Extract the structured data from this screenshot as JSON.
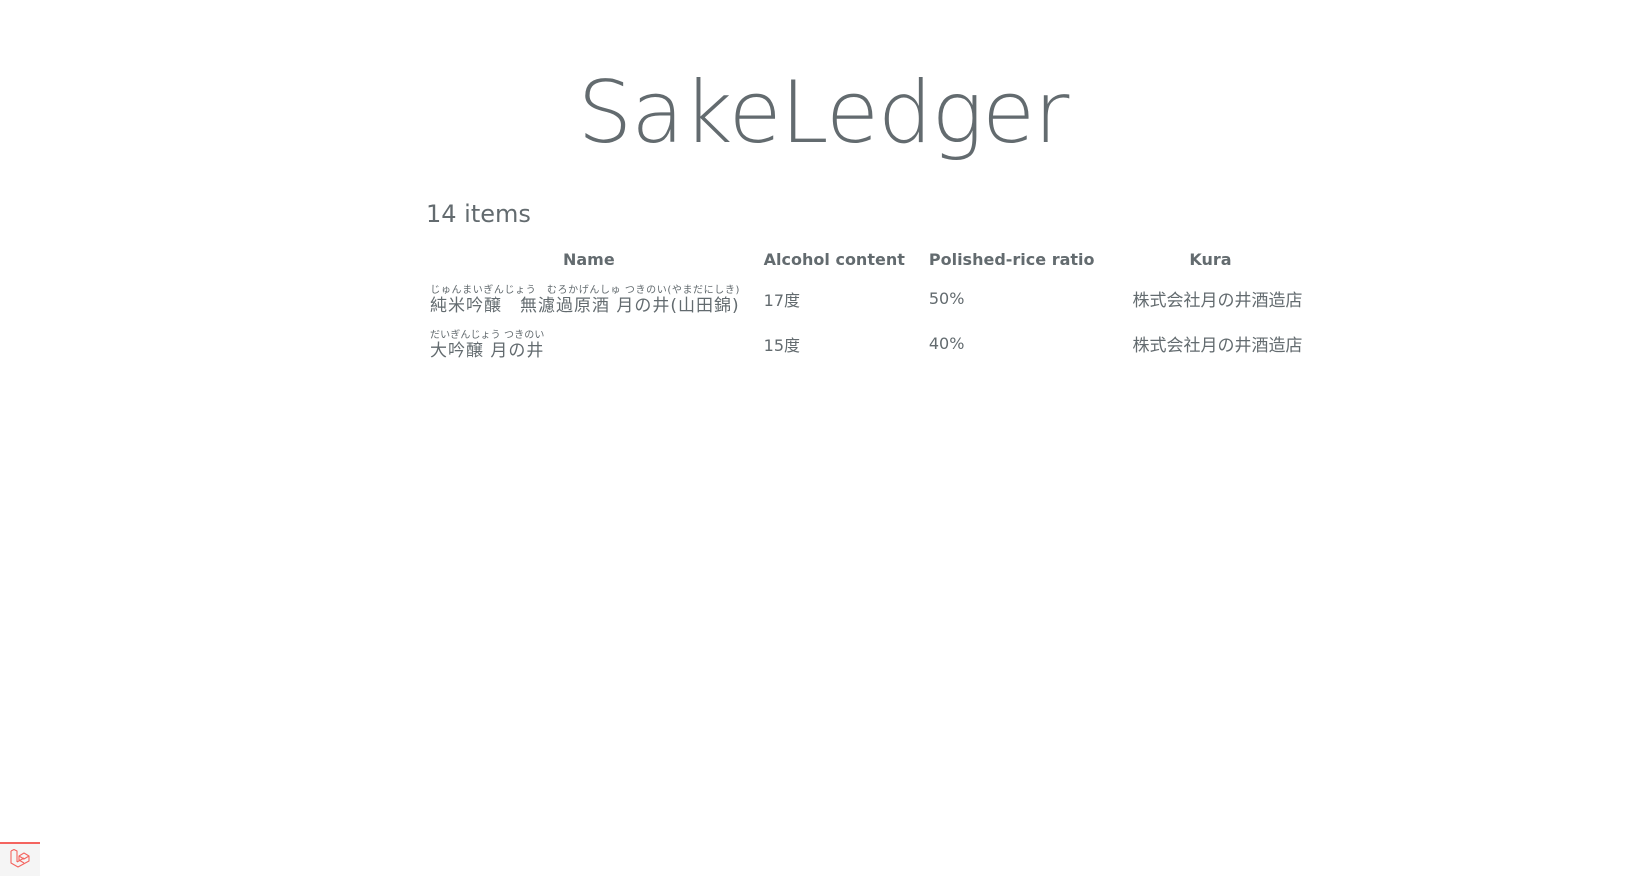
{
  "app": {
    "title": "SakeLedger"
  },
  "summary": {
    "count_label": "14 items"
  },
  "table": {
    "headers": {
      "name": "Name",
      "alcohol": "Alcohol content",
      "rice": "Polished-rice ratio",
      "kura": "Kura"
    },
    "rows": [
      {
        "name": "純米吟醸　無濾過原酒 月の井(山田錦)",
        "reading": "じゅんまいぎんじょう　むろかげんしゅ つきのい(やまだにしき)",
        "alcohol": "17度",
        "rice": "50%",
        "kura": "株式会社月の井酒造店"
      },
      {
        "name": "大吟醸 月の井",
        "reading": "だいぎんじょう つきのい",
        "alcohol": "15度",
        "rice": "40%",
        "kura": "株式会社月の井酒造店"
      }
    ]
  },
  "debugbar": {
    "icon": "laravel-icon",
    "accent": "#f4645f"
  }
}
